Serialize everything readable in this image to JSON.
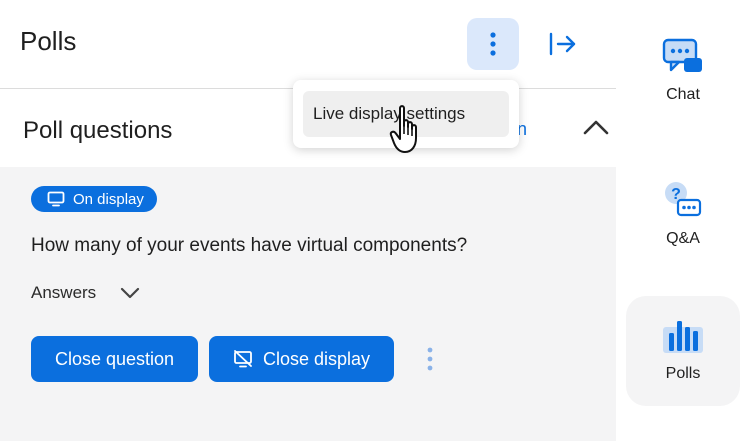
{
  "header": {
    "title": "Polls"
  },
  "menu": {
    "items": [
      "Live display settings"
    ]
  },
  "section": {
    "title": "Poll questions",
    "peek_link": "n"
  },
  "poll": {
    "badge": "On display",
    "question": "How many of your events have virtual components?",
    "answers_label": "Answers",
    "close_question_label": "Close question",
    "close_display_label": "Close display"
  },
  "rail": {
    "items": [
      {
        "label": "Chat",
        "icon": "chat-icon"
      },
      {
        "label": "Q&A",
        "icon": "qa-icon"
      },
      {
        "label": "Polls",
        "icon": "polls-icon",
        "active": true
      }
    ]
  },
  "colors": {
    "accent": "#0b6fde",
    "accent_soft": "#dbe8fb",
    "card_bg": "#f4f4f5"
  }
}
